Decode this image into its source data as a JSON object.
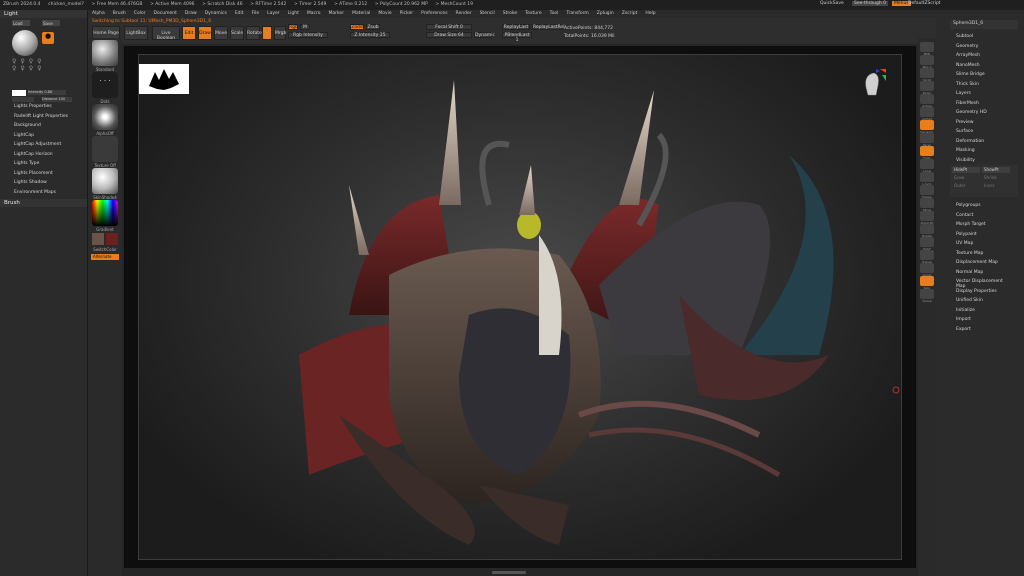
{
  "titlebar": {
    "items": [
      "ZBrush 2024.0.4",
      "chicken_model?",
      "> Free Mem 46.476GB",
      "> Active Mem 4096",
      "> Scratch Disk 46",
      "> RFTime 2.542",
      "> Timer 2.549",
      "> ATime 0.212",
      "> PolyCount 20.962 MP",
      "> MeshCount 19"
    ],
    "quicksave": "QuickSave",
    "seethrough": "See-through 0",
    "menus": "Menus",
    "default_zscript": "DefaultZScript"
  },
  "menubar": [
    "Alpha",
    "Brush",
    "Color",
    "Document",
    "Draw",
    "Dynamics",
    "Edit",
    "File",
    "Layer",
    "Light",
    "Macro",
    "Marker",
    "Material",
    "Movie",
    "Picker",
    "Preferences",
    "Render",
    "Stencil",
    "Stroke",
    "Texture",
    "Tool",
    "Transform",
    "Zplugin",
    "Zscript",
    "Help"
  ],
  "notice": "Switching to Subtool 11: UMesh_PM3D_Sphere3D1_6",
  "left_panel": {
    "title": "Light",
    "load": "Load",
    "save": "Save",
    "intensity_label": "Intensity 0.88",
    "distance_label": "Distance 100",
    "items": [
      "Lights Properties",
      "Radelift Light Properties",
      "Background",
      "LightCap",
      "LightCap Adjustment",
      "LightCap Horizon",
      "Lights Type",
      "Lights Placement",
      "Lights Shadow",
      "Environment Maps"
    ],
    "brush_title": "Brush"
  },
  "tool_shelf": {
    "home": "Home Page",
    "lightbox": "LightBox",
    "liveboolean": "Live Boolean",
    "edit": "Edit",
    "draw": "Draw",
    "move": "Move",
    "scale": "Scale",
    "rotate": "Rotate",
    "mrgb": "Mrgb",
    "rgb": "Rgb",
    "m": "M",
    "zadd": "Zadd",
    "zsub": "Zsub",
    "focal_shift": "Focal Shift 0",
    "draw_size": "Draw Size 64",
    "dynamic": "Dynamic",
    "z_intensity": "Z Intensity 25",
    "rgb_intensity": "Rgb Intensity",
    "active_points": "ActivePoints: 844,772",
    "total_points": "TotalPoints: 16.039 Mil",
    "replay_last": "ReplayLast",
    "replay_last_rel": "ReplayLastRel",
    "pblend": "PBlendLast 1"
  },
  "brush_column": [
    "Standard",
    "Dots",
    "AlphaOff",
    "Texture Off",
    "SkinShade4",
    "Gradient",
    "SwitchColor",
    "Alternate"
  ],
  "right_panel": {
    "tool_name": "Sphere3D1_6",
    "items": [
      "Subtool",
      "Geometry",
      "ArrayMesh",
      "NanoMesh",
      "Slime Bridge",
      "Thick Skin",
      "Layers",
      "FiberMesh",
      "Geometry HD",
      "Preview",
      "Surface",
      "Deformation",
      "Masking",
      "Visibility"
    ],
    "visibility_buttons": [
      "HidePt",
      "ShowPt",
      "Grow",
      "Shrink",
      "Outer",
      "Inner"
    ],
    "items2": [
      "Polygroups",
      "Contact",
      "Morph Target",
      "Polypaint",
      "UV Map",
      "Texture Map",
      "Displacement Map",
      "Normal Map",
      "Vector Displacement Map",
      "Display Properties",
      "Unified Skin",
      "Initialize",
      "Import",
      "Export"
    ]
  },
  "right_strip": [
    "BPR",
    "SPix 3",
    "Scroll",
    "Zoom",
    "Actual",
    "AAHalf",
    "Dynamic",
    "Persp",
    "Floor",
    "Local",
    "L.Sym",
    "Frame",
    "Move",
    "Zoom3D",
    "Rotate",
    "PolyF",
    "Transp",
    "Ghost",
    "Solo",
    "Xpose"
  ],
  "colors": {
    "accent": "#e87d1c",
    "bg": "#262626",
    "panel": "#2b2b2b"
  }
}
